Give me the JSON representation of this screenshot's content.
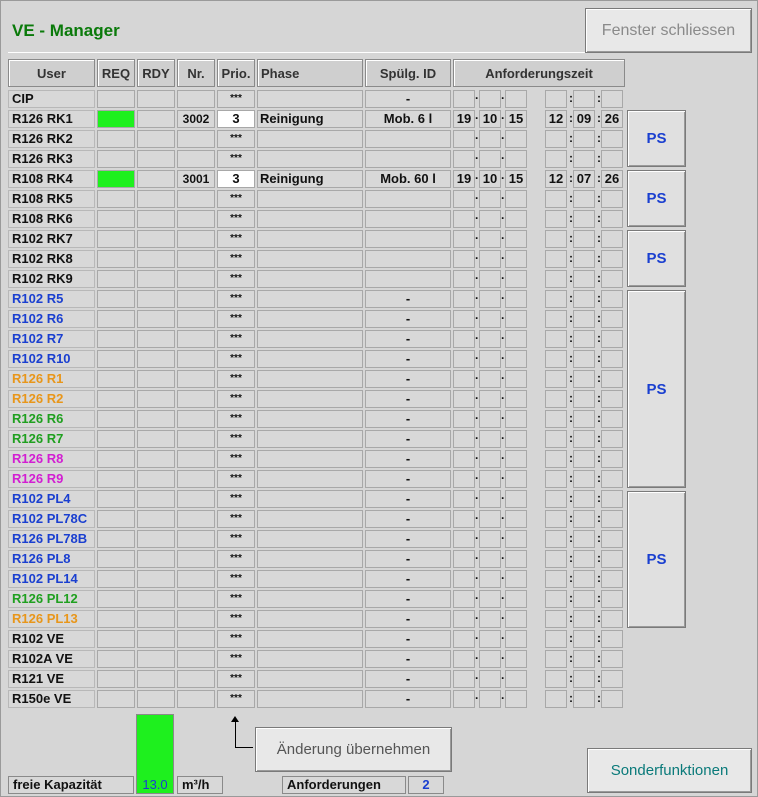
{
  "app": {
    "title": "VE - Manager",
    "close_label": "Fenster schliessen"
  },
  "headers": [
    "User",
    "REQ",
    "RDY",
    "Nr.",
    "Prio.",
    "Phase",
    "Spülg. ID",
    "Anforderungszeit"
  ],
  "rows": [
    {
      "user": "CIP",
      "color": "#111111",
      "req": false,
      "nr": "",
      "prio": "***",
      "phase": "",
      "spul": "-",
      "time": [
        "",
        "",
        "",
        "",
        "",
        ""
      ]
    },
    {
      "user": "R126 RK1",
      "color": "#111111",
      "req": true,
      "nr": "3002",
      "prio": "3",
      "phase": "Reinigung",
      "spul": "Mob. 6 l",
      "time": [
        "19",
        "10",
        "15",
        "12",
        "09",
        "26"
      ]
    },
    {
      "user": "R126 RK2",
      "color": "#111111",
      "req": false,
      "nr": "",
      "prio": "***",
      "phase": "",
      "spul": "",
      "time": [
        "",
        "",
        "",
        "",
        "",
        ""
      ]
    },
    {
      "user": "R126 RK3",
      "color": "#111111",
      "req": false,
      "nr": "",
      "prio": "***",
      "phase": "",
      "spul": "",
      "time": [
        "",
        "",
        "",
        "",
        "",
        ""
      ]
    },
    {
      "user": "R108 RK4",
      "color": "#111111",
      "req": true,
      "nr": "3001",
      "prio": "3",
      "phase": "Reinigung",
      "spul": "Mob. 60 l",
      "time": [
        "19",
        "10",
        "15",
        "12",
        "07",
        "26"
      ]
    },
    {
      "user": "R108 RK5",
      "color": "#111111",
      "req": false,
      "nr": "",
      "prio": "***",
      "phase": "",
      "spul": "",
      "time": [
        "",
        "",
        "",
        "",
        "",
        ""
      ]
    },
    {
      "user": "R108 RK6",
      "color": "#111111",
      "req": false,
      "nr": "",
      "prio": "***",
      "phase": "",
      "spul": "",
      "time": [
        "",
        "",
        "",
        "",
        "",
        ""
      ]
    },
    {
      "user": "R102 RK7",
      "color": "#111111",
      "req": false,
      "nr": "",
      "prio": "***",
      "phase": "",
      "spul": "",
      "time": [
        "",
        "",
        "",
        "",
        "",
        ""
      ]
    },
    {
      "user": "R102 RK8",
      "color": "#111111",
      "req": false,
      "nr": "",
      "prio": "***",
      "phase": "",
      "spul": "",
      "time": [
        "",
        "",
        "",
        "",
        "",
        ""
      ]
    },
    {
      "user": "R102 RK9",
      "color": "#111111",
      "req": false,
      "nr": "",
      "prio": "***",
      "phase": "",
      "spul": "",
      "time": [
        "",
        "",
        "",
        "",
        "",
        ""
      ]
    },
    {
      "user": "R102 R5",
      "color": "#1a3fd0",
      "req": false,
      "nr": "",
      "prio": "***",
      "phase": "",
      "spul": "-",
      "time": [
        "",
        "",
        "",
        "",
        "",
        ""
      ]
    },
    {
      "user": "R102 R6",
      "color": "#1a3fd0",
      "req": false,
      "nr": "",
      "prio": "***",
      "phase": "",
      "spul": "-",
      "time": [
        "",
        "",
        "",
        "",
        "",
        ""
      ]
    },
    {
      "user": "R102 R7",
      "color": "#1a3fd0",
      "req": false,
      "nr": "",
      "prio": "***",
      "phase": "",
      "spul": "-",
      "time": [
        "",
        "",
        "",
        "",
        "",
        ""
      ]
    },
    {
      "user": "R102 R10",
      "color": "#1a3fd0",
      "req": false,
      "nr": "",
      "prio": "***",
      "phase": "",
      "spul": "-",
      "time": [
        "",
        "",
        "",
        "",
        "",
        ""
      ]
    },
    {
      "user": "R126 R1",
      "color": "#e8961a",
      "req": false,
      "nr": "",
      "prio": "***",
      "phase": "",
      "spul": "-",
      "time": [
        "",
        "",
        "",
        "",
        "",
        ""
      ]
    },
    {
      "user": "R126 R2",
      "color": "#e8961a",
      "req": false,
      "nr": "",
      "prio": "***",
      "phase": "",
      "spul": "-",
      "time": [
        "",
        "",
        "",
        "",
        "",
        ""
      ]
    },
    {
      "user": "R126 R6",
      "color": "#1fa01f",
      "req": false,
      "nr": "",
      "prio": "***",
      "phase": "",
      "spul": "-",
      "time": [
        "",
        "",
        "",
        "",
        "",
        ""
      ]
    },
    {
      "user": "R126 R7",
      "color": "#1fa01f",
      "req": false,
      "nr": "",
      "prio": "***",
      "phase": "",
      "spul": "-",
      "time": [
        "",
        "",
        "",
        "",
        "",
        ""
      ]
    },
    {
      "user": "R126 R8",
      "color": "#d21ed2",
      "req": false,
      "nr": "",
      "prio": "***",
      "phase": "",
      "spul": "-",
      "time": [
        "",
        "",
        "",
        "",
        "",
        ""
      ]
    },
    {
      "user": "R126 R9",
      "color": "#d21ed2",
      "req": false,
      "nr": "",
      "prio": "***",
      "phase": "",
      "spul": "-",
      "time": [
        "",
        "",
        "",
        "",
        "",
        ""
      ]
    },
    {
      "user": "R102 PL4",
      "color": "#1a3fd0",
      "req": false,
      "nr": "",
      "prio": "***",
      "phase": "",
      "spul": "-",
      "time": [
        "",
        "",
        "",
        "",
        "",
        ""
      ]
    },
    {
      "user": "R102 PL78C",
      "color": "#1a3fd0",
      "req": false,
      "nr": "",
      "prio": "***",
      "phase": "",
      "spul": "-",
      "time": [
        "",
        "",
        "",
        "",
        "",
        ""
      ]
    },
    {
      "user": "R126 PL78B",
      "color": "#1a3fd0",
      "req": false,
      "nr": "",
      "prio": "***",
      "phase": "",
      "spul": "-",
      "time": [
        "",
        "",
        "",
        "",
        "",
        ""
      ]
    },
    {
      "user": "R126 PL8",
      "color": "#1a3fd0",
      "req": false,
      "nr": "",
      "prio": "***",
      "phase": "",
      "spul": "-",
      "time": [
        "",
        "",
        "",
        "",
        "",
        ""
      ]
    },
    {
      "user": "R102 PL14",
      "color": "#1a3fd0",
      "req": false,
      "nr": "",
      "prio": "***",
      "phase": "",
      "spul": "-",
      "time": [
        "",
        "",
        "",
        "",
        "",
        ""
      ]
    },
    {
      "user": "R126 PL12",
      "color": "#1fa01f",
      "req": false,
      "nr": "",
      "prio": "***",
      "phase": "",
      "spul": "-",
      "time": [
        "",
        "",
        "",
        "",
        "",
        ""
      ]
    },
    {
      "user": "R126 PL13",
      "color": "#e8961a",
      "req": false,
      "nr": "",
      "prio": "***",
      "phase": "",
      "spul": "-",
      "time": [
        "",
        "",
        "",
        "",
        "",
        ""
      ]
    },
    {
      "user": "R102 VE",
      "color": "#111111",
      "req": false,
      "nr": "",
      "prio": "***",
      "phase": "",
      "spul": "-",
      "time": [
        "",
        "",
        "",
        "",
        "",
        ""
      ]
    },
    {
      "user": "R102A VE",
      "color": "#111111",
      "req": false,
      "nr": "",
      "prio": "***",
      "phase": "",
      "spul": "-",
      "time": [
        "",
        "",
        "",
        "",
        "",
        ""
      ]
    },
    {
      "user": "R121 VE",
      "color": "#111111",
      "req": false,
      "nr": "",
      "prio": "***",
      "phase": "",
      "spul": "-",
      "time": [
        "",
        "",
        "",
        "",
        "",
        ""
      ]
    },
    {
      "user": "R150e VE",
      "color": "#111111",
      "req": false,
      "nr": "",
      "prio": "***",
      "phase": "",
      "spul": "-",
      "time": [
        "",
        "",
        "",
        "",
        "",
        ""
      ]
    }
  ],
  "ps_label": "PS",
  "ps_buttons": [
    1,
    2,
    3,
    4,
    5
  ],
  "bottom": {
    "capacity_label": "freie Kapazität",
    "capacity_value": "13.0",
    "capacity_unit": "m³/h",
    "requests_label": "Anforderungen",
    "requests_value": "2",
    "apply_label": "Änderung übernehmen",
    "special_label": "Sonderfunktionen"
  },
  "colors": {
    "req_active": "#1ef01e",
    "title": "#0a7a0a",
    "ps_text": "#1a3fd0"
  }
}
